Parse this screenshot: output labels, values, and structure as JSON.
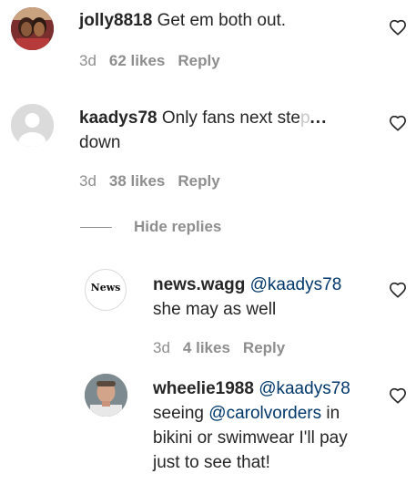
{
  "comments": [
    {
      "username": "jolly8818",
      "text": "Get em both out.",
      "time": "3d",
      "likes": "62 likes",
      "reply": "Reply"
    },
    {
      "username": "kaadys78",
      "text_visible": "Only fans next ste",
      "text_faded": "p",
      "more": "...",
      "text_line2": "down",
      "time": "3d",
      "likes": "38 likes",
      "reply": "Reply"
    }
  ],
  "hide_replies": "Hide replies",
  "replies": [
    {
      "avatar_label": "News",
      "username": "news.wagg",
      "mention": "@kaadys78",
      "text": "she may as well",
      "time": "3d",
      "likes": "4 likes",
      "reply": "Reply"
    },
    {
      "username": "wheelie1988",
      "mention": "@kaadys78",
      "text_before": "seeing",
      "mention2": "@carolvorders",
      "text_after": "in bikini or swimwear I'll pay just to see that!"
    }
  ]
}
